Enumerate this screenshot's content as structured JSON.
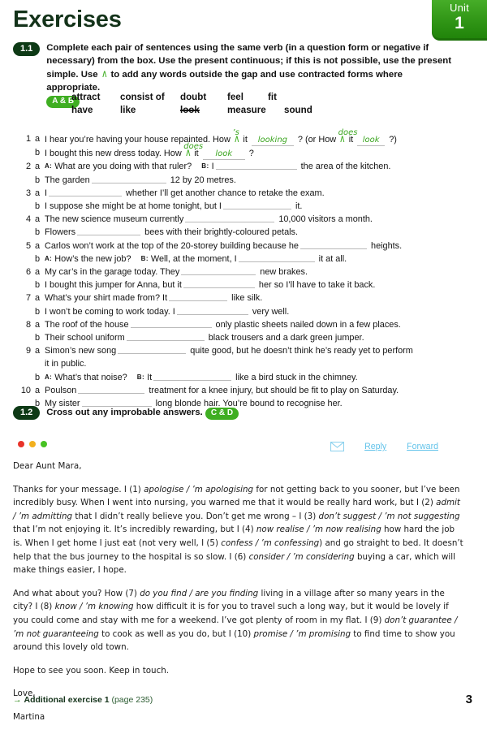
{
  "unit": {
    "label": "Unit",
    "number": "1"
  },
  "page_title": "Exercises",
  "exercise_1_1": {
    "number": "1.1",
    "rubric_part1": "Complete each pair of sentences using the same verb (in a question form or negative if necessary) from the box. Use the present continuous; if this is not possible, use the present simple. Use ",
    "rubric_part2": " to add any words outside the gap and use contracted forms where appropriate.",
    "ref": "A & B",
    "wordbank_row1": [
      "attract",
      "consist of",
      "doubt",
      "feel",
      "fit"
    ],
    "wordbank_row2": [
      "have",
      "like",
      "look",
      "measure",
      "sound"
    ],
    "wordbank_struck": "look",
    "questions": [
      {
        "num": "1",
        "letter": "a",
        "pre": "I hear you’re having your house repainted. How ",
        "caret": "∧",
        "hw_above_1": "’s",
        "mid": " it ",
        "hw_fill_1": "looking",
        "mid2": " ? (or How ",
        "caret2": "∧",
        "hw_above_2": "does",
        "mid3": " it ",
        "hw_fill_2": "look",
        "post": " ?)"
      },
      {
        "num": "",
        "letter": "b",
        "pre": "I bought this new dress today. How ",
        "caret": "∧",
        "hw_above_1": "does",
        "mid": " it ",
        "hw_fill_1": "look",
        "post": " ?"
      },
      {
        "num": "2",
        "letter": "a",
        "speaker_a": "A:",
        "pre": "What are you doing with that ruler?",
        "speaker_b": "B:",
        "mid": "I",
        "gap": 100,
        "post": "the area of the kitchen."
      },
      {
        "num": "",
        "letter": "b",
        "pre": "The garden",
        "gap": 92,
        "post": "12 by 20 metres."
      },
      {
        "num": "3",
        "letter": "a",
        "pre": "I",
        "gap": 90,
        "post": "whether I’ll get another chance to retake the exam."
      },
      {
        "num": "",
        "letter": "b",
        "pre": "I suppose she might be at home tonight, but I",
        "gap": 84,
        "post": "it."
      },
      {
        "num": "4",
        "letter": "a",
        "pre": "The new science museum currently",
        "gap": 110,
        "post": "10,000 visitors a month."
      },
      {
        "num": "",
        "letter": "b",
        "pre": "Flowers",
        "gap": 78,
        "post": "bees with their brightly-coloured petals."
      },
      {
        "num": "5",
        "letter": "a",
        "pre": "Carlos won’t work at the top of the 20-storey building because he",
        "gap": 82,
        "post": "heights."
      },
      {
        "num": "",
        "letter": "b",
        "speaker_a": "A:",
        "pre": "How’s the new job?",
        "speaker_b": "B:",
        "mid": "Well, at the moment, I",
        "gap": 94,
        "post": "it at all."
      },
      {
        "num": "6",
        "letter": "a",
        "pre": "My car’s in the garage today. They",
        "gap": 92,
        "post": "new brakes."
      },
      {
        "num": "",
        "letter": "b",
        "pre": "I bought this jumper for Anna, but it",
        "gap": 88,
        "post": "her so I’ll have to take it back."
      },
      {
        "num": "7",
        "letter": "a",
        "pre": "What’s your shirt made from? It",
        "gap": 72,
        "post": "like silk."
      },
      {
        "num": "",
        "letter": "b",
        "pre": "I won’t be coming to work today. I",
        "gap": 88,
        "post": "very well."
      },
      {
        "num": "8",
        "letter": "a",
        "pre": "The roof of the house",
        "gap": 100,
        "post": "only plastic sheets nailed down in a few places."
      },
      {
        "num": "",
        "letter": "b",
        "pre": "Their school uniform",
        "gap": 96,
        "post": "black trousers and a dark green jumper."
      },
      {
        "num": "9",
        "letter": "a",
        "pre": "Simon’s new song",
        "gap": 84,
        "post": "quite good, but he doesn’t think he’s ready yet to perform"
      },
      {
        "num": "",
        "letter": "",
        "pre": "it in public."
      },
      {
        "num": "",
        "letter": "b",
        "speaker_a": "A:",
        "pre": "What’s that noise?",
        "speaker_b": "B:",
        "mid": "It",
        "gap": 96,
        "post": "like a bird stuck in the chimney."
      },
      {
        "num": "10",
        "letter": "a",
        "pre": "Poulson",
        "gap": 82,
        "post": "treatment for a knee injury, but should be fit to play on Saturday."
      },
      {
        "num": "",
        "letter": "b",
        "pre": "My sister",
        "gap": 86,
        "post": "long blonde hair. You’re bound to recognise her."
      }
    ]
  },
  "exercise_1_2": {
    "number": "1.2",
    "rubric": "Cross out any improbable answers.",
    "ref": "C & D"
  },
  "email": {
    "window_dots": [
      "red",
      "amber",
      "green"
    ],
    "envelope_icon": "envelope-icon",
    "reply_label": "Reply",
    "forward_label": "Forward",
    "greeting": "Dear Aunt Mara,",
    "paragraph_1_parts": [
      {
        "t": "Thanks for your message. I (1) ",
        "i": false
      },
      {
        "t": "apologise / ’m apologising",
        "i": true
      },
      {
        "t": " for not getting back to you sooner, but I’ve been incredibly busy. When I went into nursing, you warned me that it would be really hard work, but I (2) ",
        "i": false
      },
      {
        "t": "admit / ’m admitting",
        "i": true
      },
      {
        "t": " that I didn’t really believe you. Don’t get me wrong – I (3) ",
        "i": false
      },
      {
        "t": "don’t suggest / ’m not suggesting",
        "i": true
      },
      {
        "t": " that I’m not enjoying it. It’s incredibly rewarding, but I (4) ",
        "i": false
      },
      {
        "t": "now realise / ’m now realising",
        "i": true
      },
      {
        "t": " how hard the job is. When I get home I just eat (not very well, I (5) ",
        "i": false
      },
      {
        "t": "confess / ’m confessing",
        "i": true
      },
      {
        "t": ") and go straight to bed. It doesn’t help that the bus journey to the hospital is so slow. I (6) ",
        "i": false
      },
      {
        "t": "consider / ’m considering",
        "i": true
      },
      {
        "t": " buying a car, which will make things easier, I hope.",
        "i": false
      }
    ],
    "paragraph_2_parts": [
      {
        "t": "And what about you? How (7) ",
        "i": false
      },
      {
        "t": "do you find / are you finding",
        "i": true
      },
      {
        "t": " living in a village after so many years in the city? I (8) ",
        "i": false
      },
      {
        "t": "know / ’m knowing",
        "i": true
      },
      {
        "t": " how difficult it is for you to travel such a long way, but it would be lovely if you could come and stay with me for a weekend. I’ve got plenty of room in my flat. I (9) ",
        "i": false
      },
      {
        "t": "don’t guarantee / ’m not guaranteeing",
        "i": true
      },
      {
        "t": " to cook as well as you do, but I (10) ",
        "i": false
      },
      {
        "t": "promise / ’m promising",
        "i": true
      },
      {
        "t": " to find time to show you around this lovely old town.",
        "i": false
      }
    ],
    "closing_1": "Hope to see you soon. Keep in touch.",
    "closing_2": "Love,",
    "signature": "Martina"
  },
  "footer": {
    "arrow": "→",
    "link_label": "Additional exercise 1",
    "page_ref": "(page 235)",
    "page_number": "3"
  },
  "colors": {
    "brand_green": "#3fae22",
    "dark_green": "#0e3a16",
    "handwriting_green": "#3aa51f",
    "link_blue": "#63c3ea"
  }
}
